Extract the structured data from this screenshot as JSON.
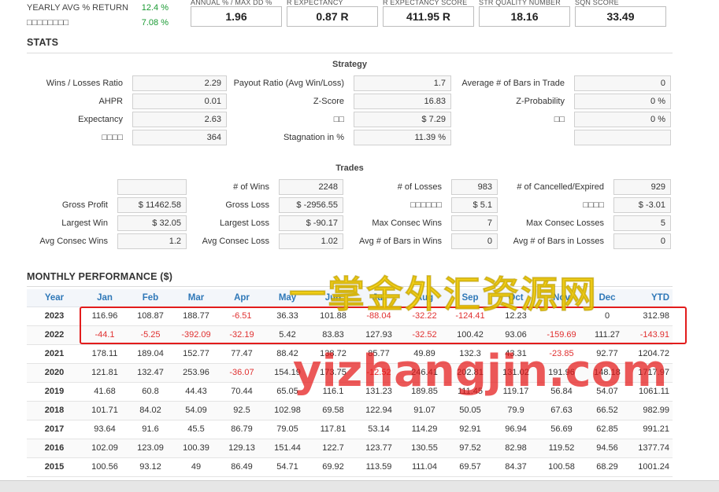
{
  "top_left": [
    {
      "label": "YEARLY AVG % RETURN",
      "value": "12.4 %"
    },
    {
      "label": "□□□□□□□□",
      "value": "7.08 %"
    }
  ],
  "metrics": [
    {
      "label": "ANNUAL % / MAX DD %",
      "value": "1.96"
    },
    {
      "label": "R EXPECTANCY",
      "value": "0.87 R"
    },
    {
      "label": "R EXPECTANCY SCORE",
      "value": "411.95 R"
    },
    {
      "label": "STR QUALITY NUMBER",
      "value": "18.16"
    },
    {
      "label": "SQN SCORE",
      "value": "33.49"
    }
  ],
  "stats_title": "STATS",
  "strategy": {
    "title": "Strategy",
    "rows": [
      [
        {
          "label": "Wins / Losses Ratio",
          "value": "2.29"
        },
        {
          "label": "Payout Ratio (Avg Win/Loss)",
          "value": "1.7"
        },
        {
          "label": "Average # of Bars in Trade",
          "value": "0"
        }
      ],
      [
        {
          "label": "AHPR",
          "value": "0.01"
        },
        {
          "label": "Z-Score",
          "value": "16.83"
        },
        {
          "label": "Z-Probability",
          "value": "0 %"
        }
      ],
      [
        {
          "label": "Expectancy",
          "value": "2.63"
        },
        {
          "label": "□□",
          "value": "$ 7.29"
        },
        {
          "label": "□□",
          "value": "0 %"
        }
      ],
      [
        {
          "label": "□□□□",
          "value": "364"
        },
        {
          "label": "Stagnation in %",
          "value": "11.39 %"
        },
        {
          "label": "",
          "value": ""
        }
      ]
    ]
  },
  "trades": {
    "title": "Trades",
    "rows": [
      [
        {
          "label": "",
          "value": ""
        },
        {
          "label": "# of Wins",
          "value": "2248"
        },
        {
          "label": "# of Losses",
          "value": "983"
        },
        {
          "label": "# of Cancelled/Expired",
          "value": "929"
        }
      ],
      [
        {
          "label": "Gross Profit",
          "value": "$ 11462.58"
        },
        {
          "label": "Gross Loss",
          "value": "$ -2956.55"
        },
        {
          "label": "□□□□□□",
          "value": "$ 5.1"
        },
        {
          "label": "□□□□",
          "value": "$ -3.01"
        }
      ],
      [
        {
          "label": "Largest Win",
          "value": "$ 32.05"
        },
        {
          "label": "Largest Loss",
          "value": "$ -90.17"
        },
        {
          "label": "Max Consec Wins",
          "value": "7"
        },
        {
          "label": "Max Consec Losses",
          "value": "5"
        }
      ],
      [
        {
          "label": "Avg Consec Wins",
          "value": "1.2"
        },
        {
          "label": "Avg Consec Loss",
          "value": "1.02"
        },
        {
          "label": "Avg # of Bars in Wins",
          "value": "0"
        },
        {
          "label": "Avg # of Bars in Losses",
          "value": "0"
        }
      ]
    ]
  },
  "monthly": {
    "title": "MONTHLY PERFORMANCE ($)",
    "headers": [
      "Year",
      "Jan",
      "Feb",
      "Mar",
      "Apr",
      "May",
      "Jun",
      "Jul",
      "Aug",
      "Sep",
      "Oct",
      "Nov",
      "Dec",
      "YTD"
    ],
    "rows": [
      [
        "2023",
        "116.96",
        "108.87",
        "188.77",
        "-6.51",
        "36.33",
        "101.88",
        "-88.04",
        "-32.22",
        "-124.41",
        "12.23",
        "",
        "0",
        "312.98"
      ],
      [
        "2022",
        "-44.1",
        "-5.25",
        "-392.09",
        "-32.19",
        "5.42",
        "83.83",
        "127.93",
        "-32.52",
        "100.42",
        "93.06",
        "-159.69",
        "111.27",
        "-143.91"
      ],
      [
        "2021",
        "178.11",
        "189.04",
        "152.77",
        "77.47",
        "88.42",
        "138.72",
        "85.77",
        "49.89",
        "132.3",
        "43.31",
        "-23.85",
        "92.77",
        "1204.72"
      ],
      [
        "2020",
        "121.81",
        "132.47",
        "253.96",
        "-36.07",
        "154.19",
        "173.75",
        "-12.52",
        "246.41",
        "202.81",
        "131.02",
        "191.96",
        "148.18",
        "1717.97"
      ],
      [
        "2019",
        "41.68",
        "60.8",
        "44.43",
        "70.44",
        "65.05",
        "116.1",
        "131.23",
        "189.85",
        "111.45",
        "119.17",
        "56.84",
        "54.07",
        "1061.11"
      ],
      [
        "2018",
        "101.71",
        "84.02",
        "54.09",
        "92.5",
        "102.98",
        "69.58",
        "122.94",
        "91.07",
        "50.05",
        "79.9",
        "67.63",
        "66.52",
        "982.99"
      ],
      [
        "2017",
        "93.64",
        "91.6",
        "45.5",
        "86.79",
        "79.05",
        "117.81",
        "53.14",
        "114.29",
        "92.91",
        "96.94",
        "56.69",
        "62.85",
        "991.21"
      ],
      [
        "2016",
        "102.09",
        "123.09",
        "100.39",
        "129.13",
        "151.44",
        "122.7",
        "123.77",
        "130.55",
        "97.52",
        "82.98",
        "119.52",
        "94.56",
        "1377.74"
      ],
      [
        "2015",
        "100.56",
        "93.12",
        "49",
        "86.49",
        "54.71",
        "69.92",
        "113.59",
        "111.04",
        "69.57",
        "84.37",
        "100.58",
        "68.29",
        "1001.24"
      ]
    ]
  },
  "watermark": {
    "cn": "一掌金外汇资源网",
    "url": "yizhangjin.com"
  },
  "colors": {
    "positive": "#1a9a33",
    "negative": "#e03030",
    "header_blue": "#2f78b8",
    "highlight": "#e21c1c"
  }
}
